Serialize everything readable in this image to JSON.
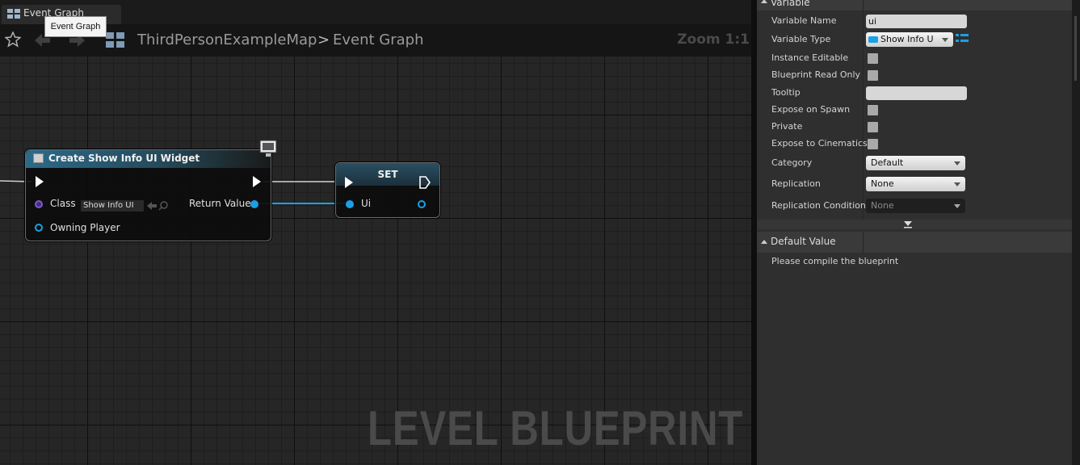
{
  "graph_tab": {
    "label": "Event Graph",
    "tooltip": "Event Graph"
  },
  "breadcrumb": {
    "map": "ThirdPersonExampleMap",
    "separator": ">",
    "graph": "Event Graph",
    "zoom": "Zoom 1:1"
  },
  "watermark": "LEVEL BLUEPRINT",
  "create_widget_node": {
    "title": "Create Show Info UI Widget",
    "class_label": "Class",
    "class_value": "Show Info UI",
    "return_value_label": "Return Value",
    "owning_player_label": "Owning Player"
  },
  "set_node": {
    "title": "SET",
    "pin_label": "Ui"
  },
  "details": {
    "variable_section": "Variable",
    "default_section": "Default Value",
    "compile_message": "Please compile the blueprint",
    "rows": {
      "variable_name": {
        "label": "Variable Name",
        "value": "ui"
      },
      "variable_type": {
        "label": "Variable Type",
        "value": "Show Info U"
      },
      "instance_editable": {
        "label": "Instance Editable"
      },
      "read_only": {
        "label": "Blueprint Read Only"
      },
      "tooltip": {
        "label": "Tooltip",
        "value": ""
      },
      "expose_on_spawn": {
        "label": "Expose on Spawn"
      },
      "private": {
        "label": "Private"
      },
      "expose_cinematics": {
        "label": "Expose to Cinematics"
      },
      "category": {
        "label": "Category",
        "value": "Default"
      },
      "replication": {
        "label": "Replication",
        "value": "None"
      },
      "replication_condition": {
        "label": "Replication Condition",
        "value": "None"
      }
    }
  },
  "colors": {
    "pin_object": "#1aa0e6",
    "class_pin": "#7a5ad0",
    "node_header": "#2c6a8a"
  }
}
